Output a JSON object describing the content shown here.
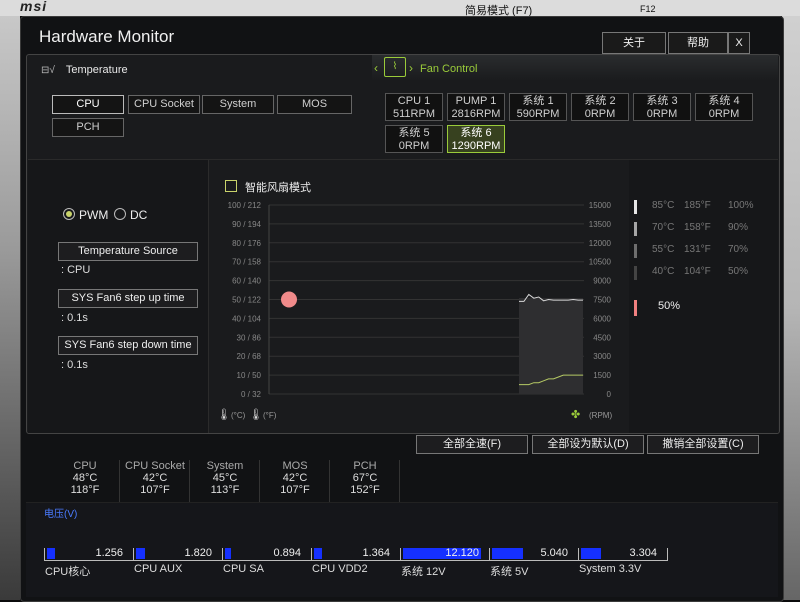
{
  "window": {
    "title": "Hardware Monitor",
    "close_label": "关于",
    "help_label": "帮助",
    "x_label": "X",
    "simple_mode_label": "简易模式 (F7)",
    "f12_label": "F12"
  },
  "tabs": {
    "temperature": "Temperature",
    "fan_control": "Fan Control"
  },
  "sources": [
    {
      "label": "CPU",
      "active": true
    },
    {
      "label": "CPU Socket"
    },
    {
      "label": "System"
    },
    {
      "label": "MOS"
    },
    {
      "label": "PCH"
    }
  ],
  "fans": [
    {
      "name": "CPU 1",
      "rpm": "511RPM"
    },
    {
      "name": "PUMP 1",
      "rpm": "2816RPM"
    },
    {
      "name": "系统 1",
      "rpm": "590RPM"
    },
    {
      "name": "系统 2",
      "rpm": "0RPM"
    },
    {
      "name": "系统 3",
      "rpm": "0RPM"
    },
    {
      "name": "系统 4",
      "rpm": "0RPM"
    },
    {
      "name": "系统 5",
      "rpm": "0RPM"
    },
    {
      "name": "系统 6",
      "rpm": "1290RPM",
      "active": true
    }
  ],
  "mode": {
    "pwm": "PWM",
    "dc": "DC",
    "temperature_source_label": "Temperature Source",
    "temperature_source_value": ": CPU",
    "step_up_label": "SYS Fan6 step up time",
    "step_up_value": ": 0.1s",
    "step_down_label": "SYS Fan6 step down time",
    "step_down_value": ": 0.1s"
  },
  "smart_fan_label": "智能风扇模式",
  "chart_data": {
    "type": "line",
    "y_left_ticks": [
      "100 / 212",
      "90 / 194",
      "80 / 176",
      "70 / 158",
      "60 / 140",
      "50 / 122",
      "40 / 104",
      "30 /  86",
      "20 /  68",
      "10 /  50",
      "0 /  32"
    ],
    "y_right_ticks": [
      "15000",
      "13500",
      "12000",
      "10500",
      "9000",
      "7500",
      "6000",
      "4500",
      "3000",
      "1500",
      "0"
    ],
    "x_label_c": "(°C)",
    "x_label_f": "(°F)",
    "rpm_label": "(RPM)",
    "ylim_left": [
      0,
      100
    ],
    "ylim_right": [
      0,
      15000
    ],
    "setpoint": {
      "temp": 50,
      "percent": 50
    },
    "rpm_history": [
      7350,
      7350,
      7900,
      7600,
      7700,
      7400,
      7500,
      7450,
      7450,
      7450,
      7450,
      7500,
      7450,
      7450
    ],
    "temp_history": [
      5,
      5,
      5,
      6,
      6,
      7,
      8,
      8,
      9,
      10,
      10,
      10,
      10,
      10
    ],
    "grid": true
  },
  "legend": [
    {
      "c": "85°C",
      "f": "185°F",
      "p": "100%",
      "color": "#e6e6e6"
    },
    {
      "c": "70°C",
      "f": "158°F",
      "p": "90%",
      "color": "#a6a6a6"
    },
    {
      "c": "55°C",
      "f": "131°F",
      "p": "70%",
      "color": "#6e6e6e"
    },
    {
      "c": "40°C",
      "f": "104°F",
      "p": "50%",
      "color": "#444444"
    }
  ],
  "current_percent": "50%",
  "current_color": "#f08080",
  "actions": {
    "full_speed": "全部全速(F)",
    "set_default": "全部设为默认(D)",
    "cancel_all": "撤销全部设置(C)"
  },
  "temps": [
    {
      "name": "CPU",
      "c": "48°C",
      "f": "118°F"
    },
    {
      "name": "CPU Socket",
      "c": "42°C",
      "f": "107°F"
    },
    {
      "name": "System",
      "c": "45°C",
      "f": "113°F"
    },
    {
      "name": "MOS",
      "c": "42°C",
      "f": "107°F"
    },
    {
      "name": "PCH",
      "c": "67°C",
      "f": "152°F"
    }
  ],
  "voltage_title": "电压(V)",
  "voltages": [
    {
      "name": "CPU核心",
      "value": "1.256",
      "fill": 0.1
    },
    {
      "name": "CPU AUX",
      "value": "1.820",
      "fill": 0.12
    },
    {
      "name": "CPU SA",
      "value": "0.894",
      "fill": 0.08
    },
    {
      "name": "CPU VDD2",
      "value": "1.364",
      "fill": 0.1
    },
    {
      "name": "系统 12V",
      "value": "12.120",
      "fill": 1.0
    },
    {
      "name": "系统 5V",
      "value": "5.040",
      "fill": 0.4
    },
    {
      "name": "System 3.3V",
      "value": "3.304",
      "fill": 0.26
    }
  ]
}
